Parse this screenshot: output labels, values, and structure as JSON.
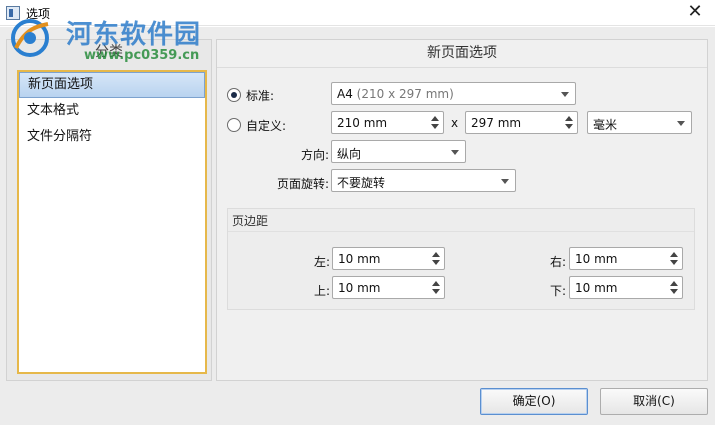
{
  "window": {
    "title": "选项",
    "close_glyph": "✕"
  },
  "watermark": {
    "main": "河东软件园",
    "url": "www.pc0359.cn"
  },
  "category": {
    "header": "分类",
    "items": [
      {
        "label": "新页面选项",
        "selected": true
      },
      {
        "label": "文本格式",
        "selected": false
      },
      {
        "label": "文件分隔符",
        "selected": false
      }
    ]
  },
  "page_options": {
    "title": "新页面选项",
    "standard_label": "标准:",
    "standard_selected": true,
    "standard_value": "A4",
    "standard_detail": "(210 x 297 mm)",
    "custom_label": "自定义:",
    "custom_selected": false,
    "custom_width": "210 mm",
    "times_glyph": "x",
    "custom_height": "297 mm",
    "unit_value": "毫米",
    "orientation_label": "方向:",
    "orientation_value": "纵向",
    "rotation_label": "页面旋转:",
    "rotation_value": "不要旋转"
  },
  "margins": {
    "title": "页边距",
    "left_label": "左:",
    "left_value": "10 mm",
    "right_label": "右:",
    "right_value": "10 mm",
    "top_label": "上:",
    "top_value": "10 mm",
    "bottom_label": "下:",
    "bottom_value": "10 mm"
  },
  "buttons": {
    "ok_label": "确定(O)",
    "cancel_label": "取消(C)"
  },
  "colors": {
    "accent": "#7da2ce",
    "list_border": "#e6b84a",
    "watermark_blue": "#2678c8",
    "watermark_green": "#288c3c"
  },
  "icons": [
    "app-icon",
    "close-icon",
    "radio-icon",
    "dropdown-arrow-icon",
    "spin-arrows-icon"
  ]
}
